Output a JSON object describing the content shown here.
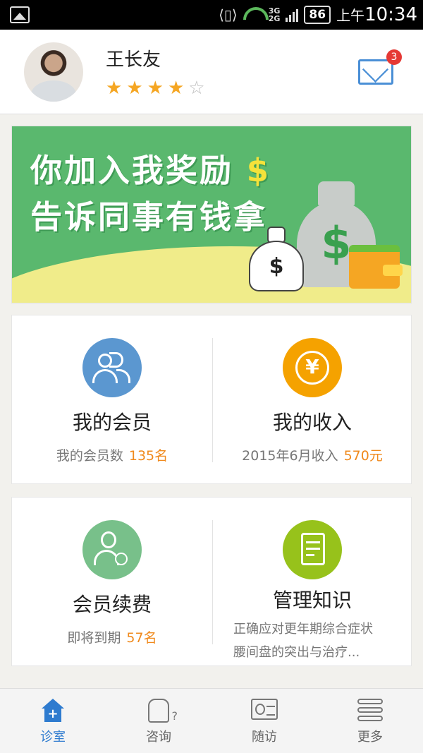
{
  "statusbar": {
    "network": "3G\n2G",
    "battery": "86",
    "ampm": "上午",
    "time": "10:34"
  },
  "header": {
    "username": "王长友",
    "rating": 4,
    "rating_max": 5,
    "unread_count": "3"
  },
  "banner": {
    "line1": "你加入我奖励",
    "line1_symbol": "$",
    "line2": "告诉同事有钱拿",
    "bag_symbol": "$"
  },
  "grid": {
    "members": {
      "title": "我的会员",
      "sub_label": "我的会员数",
      "sub_value": "135名"
    },
    "income": {
      "title": "我的收入",
      "sub_label": "2015年6月收入",
      "sub_value": "570元",
      "icon_glyph": "¥"
    },
    "renewal": {
      "title": "会员续费",
      "sub_label": "即将到期",
      "sub_value": "57名"
    },
    "knowledge": {
      "title": "管理知识",
      "line1": "正确应对更年期综合症状",
      "line2": "腰间盘的突出与治疗..."
    }
  },
  "nav": {
    "items": [
      {
        "label": "诊室",
        "icon": "clinic-icon",
        "active": true
      },
      {
        "label": "咨询",
        "icon": "consult-icon",
        "active": false
      },
      {
        "label": "随访",
        "icon": "follow-up-icon",
        "active": false
      },
      {
        "label": "更多",
        "icon": "more-icon",
        "active": false
      }
    ]
  },
  "colors": {
    "accent_blue": "#2e7bcf",
    "highlight_orange": "#f08a1d",
    "banner_green": "#5ab86e",
    "star_gold": "#f5a623"
  }
}
